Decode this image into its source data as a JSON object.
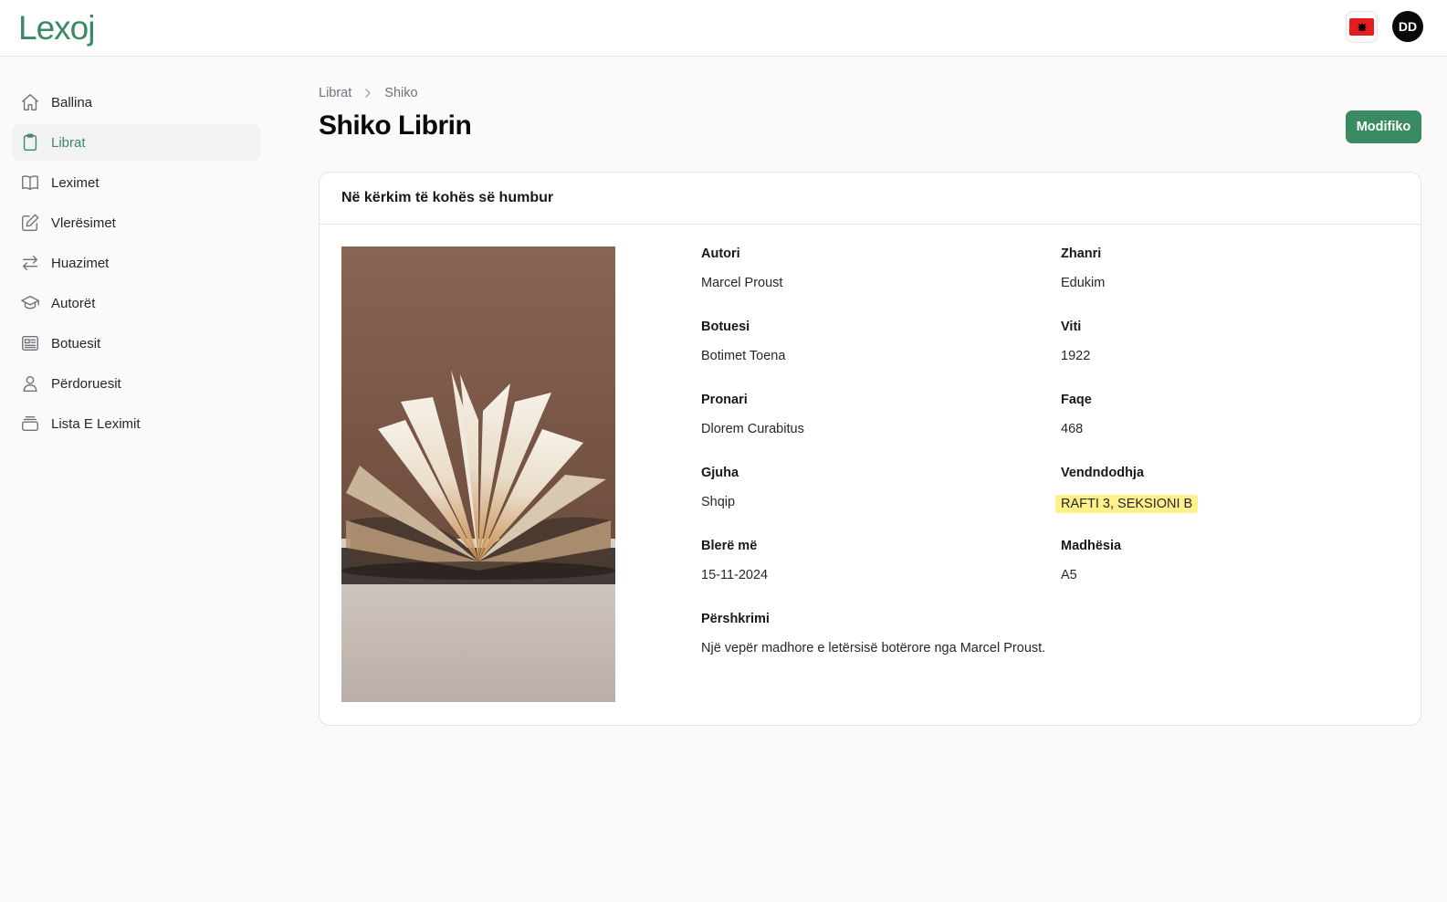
{
  "app": {
    "logo": "Lexoj",
    "avatar_initials": "DD"
  },
  "sidebar": {
    "items": [
      {
        "label": "Ballina",
        "icon": "home-icon",
        "active": false
      },
      {
        "label": "Librat",
        "icon": "clipboard-icon",
        "active": true
      },
      {
        "label": "Leximet",
        "icon": "open-book-icon",
        "active": false
      },
      {
        "label": "Vlerësimet",
        "icon": "pencil-square-icon",
        "active": false
      },
      {
        "label": "Huazimet",
        "icon": "arrows-swap-icon",
        "active": false
      },
      {
        "label": "Autorët",
        "icon": "graduation-cap-icon",
        "active": false
      },
      {
        "label": "Botuesit",
        "icon": "newspaper-icon",
        "active": false
      },
      {
        "label": "Përdoruesit",
        "icon": "user-icon",
        "active": false
      },
      {
        "label": "Lista E Leximit",
        "icon": "stack-icon",
        "active": false
      }
    ]
  },
  "breadcrumb": {
    "parent": "Librat",
    "current": "Shiko"
  },
  "page": {
    "title": "Shiko Librin",
    "edit_label": "Modifiko"
  },
  "book": {
    "title": "Në kërkim të kohës së humbur",
    "fields": {
      "author": {
        "label": "Autori",
        "value": "Marcel Proust"
      },
      "genre": {
        "label": "Zhanri",
        "value": "Edukim"
      },
      "publisher": {
        "label": "Botuesi",
        "value": "Botimet Toena"
      },
      "year": {
        "label": "Viti",
        "value": "1922"
      },
      "owner": {
        "label": "Pronari",
        "value": "Dlorem Curabitus"
      },
      "pages": {
        "label": "Faqe",
        "value": "468"
      },
      "language": {
        "label": "Gjuha",
        "value": "Shqip"
      },
      "location": {
        "label": "Vendndodhja",
        "value": "RAFTI 3, SEKSIONI B"
      },
      "bought": {
        "label": "Blerë më",
        "value": "15-11-2024"
      },
      "size": {
        "label": "Madhësia",
        "value": "A5"
      },
      "description": {
        "label": "Përshkrimi",
        "value": "Një vepër madhore e letërsisë botërore nga Marcel Proust."
      }
    }
  },
  "colors": {
    "brand": "#3a8a62",
    "highlight": "#fef08a",
    "flag_red": "#e41e20"
  }
}
